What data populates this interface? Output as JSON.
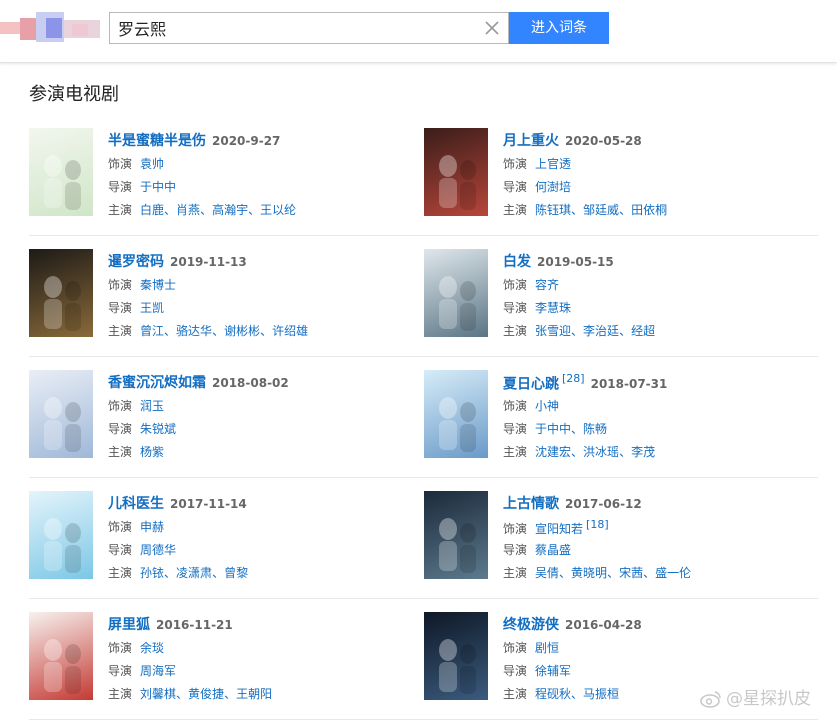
{
  "search": {
    "query": "罗云熙",
    "button_label": "进入词条"
  },
  "section_title": "参演电视剧",
  "labels": {
    "role": "饰演",
    "director": "导演",
    "starring": "主演"
  },
  "dramas": [
    {
      "title": "半是蜜糖半是伤",
      "citation": "",
      "date": "2020-9-27",
      "role": [
        "袁帅"
      ],
      "role_citation": "",
      "director": [
        "于中中"
      ],
      "starring": [
        "白鹿",
        "肖燕",
        "高瀚宇",
        "王以纶"
      ],
      "poster_colors": [
        "#f3f6ee",
        "#cfe6c8"
      ]
    },
    {
      "title": "月上重火",
      "citation": "",
      "date": "2020-05-28",
      "role": [
        "上官透"
      ],
      "role_citation": "",
      "director": [
        "何澍培"
      ],
      "starring": [
        "陈钰琪",
        "邹廷威",
        "田依桐"
      ],
      "poster_colors": [
        "#3a1d1a",
        "#b8463a"
      ]
    },
    {
      "title": "暹罗密码",
      "citation": "",
      "date": "2019-11-13",
      "role": [
        "秦博士"
      ],
      "role_citation": "",
      "director": [
        "王凯"
      ],
      "starring": [
        "曾江",
        "骆达华",
        "谢彬彬",
        "许绍雄"
      ],
      "poster_colors": [
        "#1d1a17",
        "#8a6a3a"
      ]
    },
    {
      "title": "白发",
      "citation": "",
      "date": "2019-05-15",
      "role": [
        "容齐"
      ],
      "role_citation": "",
      "director": [
        "李慧珠"
      ],
      "starring": [
        "张雪迎",
        "李治廷",
        "经超"
      ],
      "poster_colors": [
        "#dfe7ec",
        "#5a7584"
      ]
    },
    {
      "title": "香蜜沉沉烬如霜",
      "citation": "",
      "date": "2018-08-02",
      "role": [
        "润玉"
      ],
      "role_citation": "",
      "director": [
        "朱锐斌"
      ],
      "starring": [
        "杨紫"
      ],
      "poster_colors": [
        "#e9eef6",
        "#9fb8d8"
      ]
    },
    {
      "title": "夏日心跳",
      "citation": "[28]",
      "date": "2018-07-31",
      "role": [
        "小神"
      ],
      "role_citation": "",
      "director": [
        "于中中",
        "陈畅"
      ],
      "starring": [
        "沈建宏",
        "洪冰瑶",
        "李茂"
      ],
      "poster_colors": [
        "#d6ecf8",
        "#6a9ac8"
      ]
    },
    {
      "title": "儿科医生",
      "citation": "",
      "date": "2017-11-14",
      "role": [
        "申赫"
      ],
      "role_citation": "",
      "director": [
        "周德华"
      ],
      "starring": [
        "孙铱",
        "凌潇肃",
        "曾黎"
      ],
      "poster_colors": [
        "#e4f4fb",
        "#7cc7e6"
      ]
    },
    {
      "title": "上古情歌",
      "citation": "",
      "date": "2017-06-12",
      "role": [
        "宣阳知若"
      ],
      "role_citation": "[18]",
      "director": [
        "蔡晶盛"
      ],
      "starring": [
        "吴倩",
        "黄晓明",
        "宋茜",
        "盛一伦"
      ],
      "poster_colors": [
        "#1b2a3a",
        "#5d7a8e"
      ]
    },
    {
      "title": "屏里狐",
      "citation": "",
      "date": "2016-11-21",
      "role": [
        "余琰"
      ],
      "role_citation": "",
      "director": [
        "周海军"
      ],
      "starring": [
        "刘馨棋",
        "黄俊捷",
        "王朝阳"
      ],
      "poster_colors": [
        "#f7f1ef",
        "#c43a33"
      ]
    },
    {
      "title": "终极游侠",
      "citation": "",
      "date": "2016-04-28",
      "role": [
        "剧恒"
      ],
      "role_citation": "",
      "director": [
        "徐辅军"
      ],
      "starring": [
        "程砚秋",
        "马振桓"
      ],
      "poster_colors": [
        "#0e1826",
        "#3b5b7e"
      ]
    }
  ],
  "watermark": "@星探扒皮"
}
